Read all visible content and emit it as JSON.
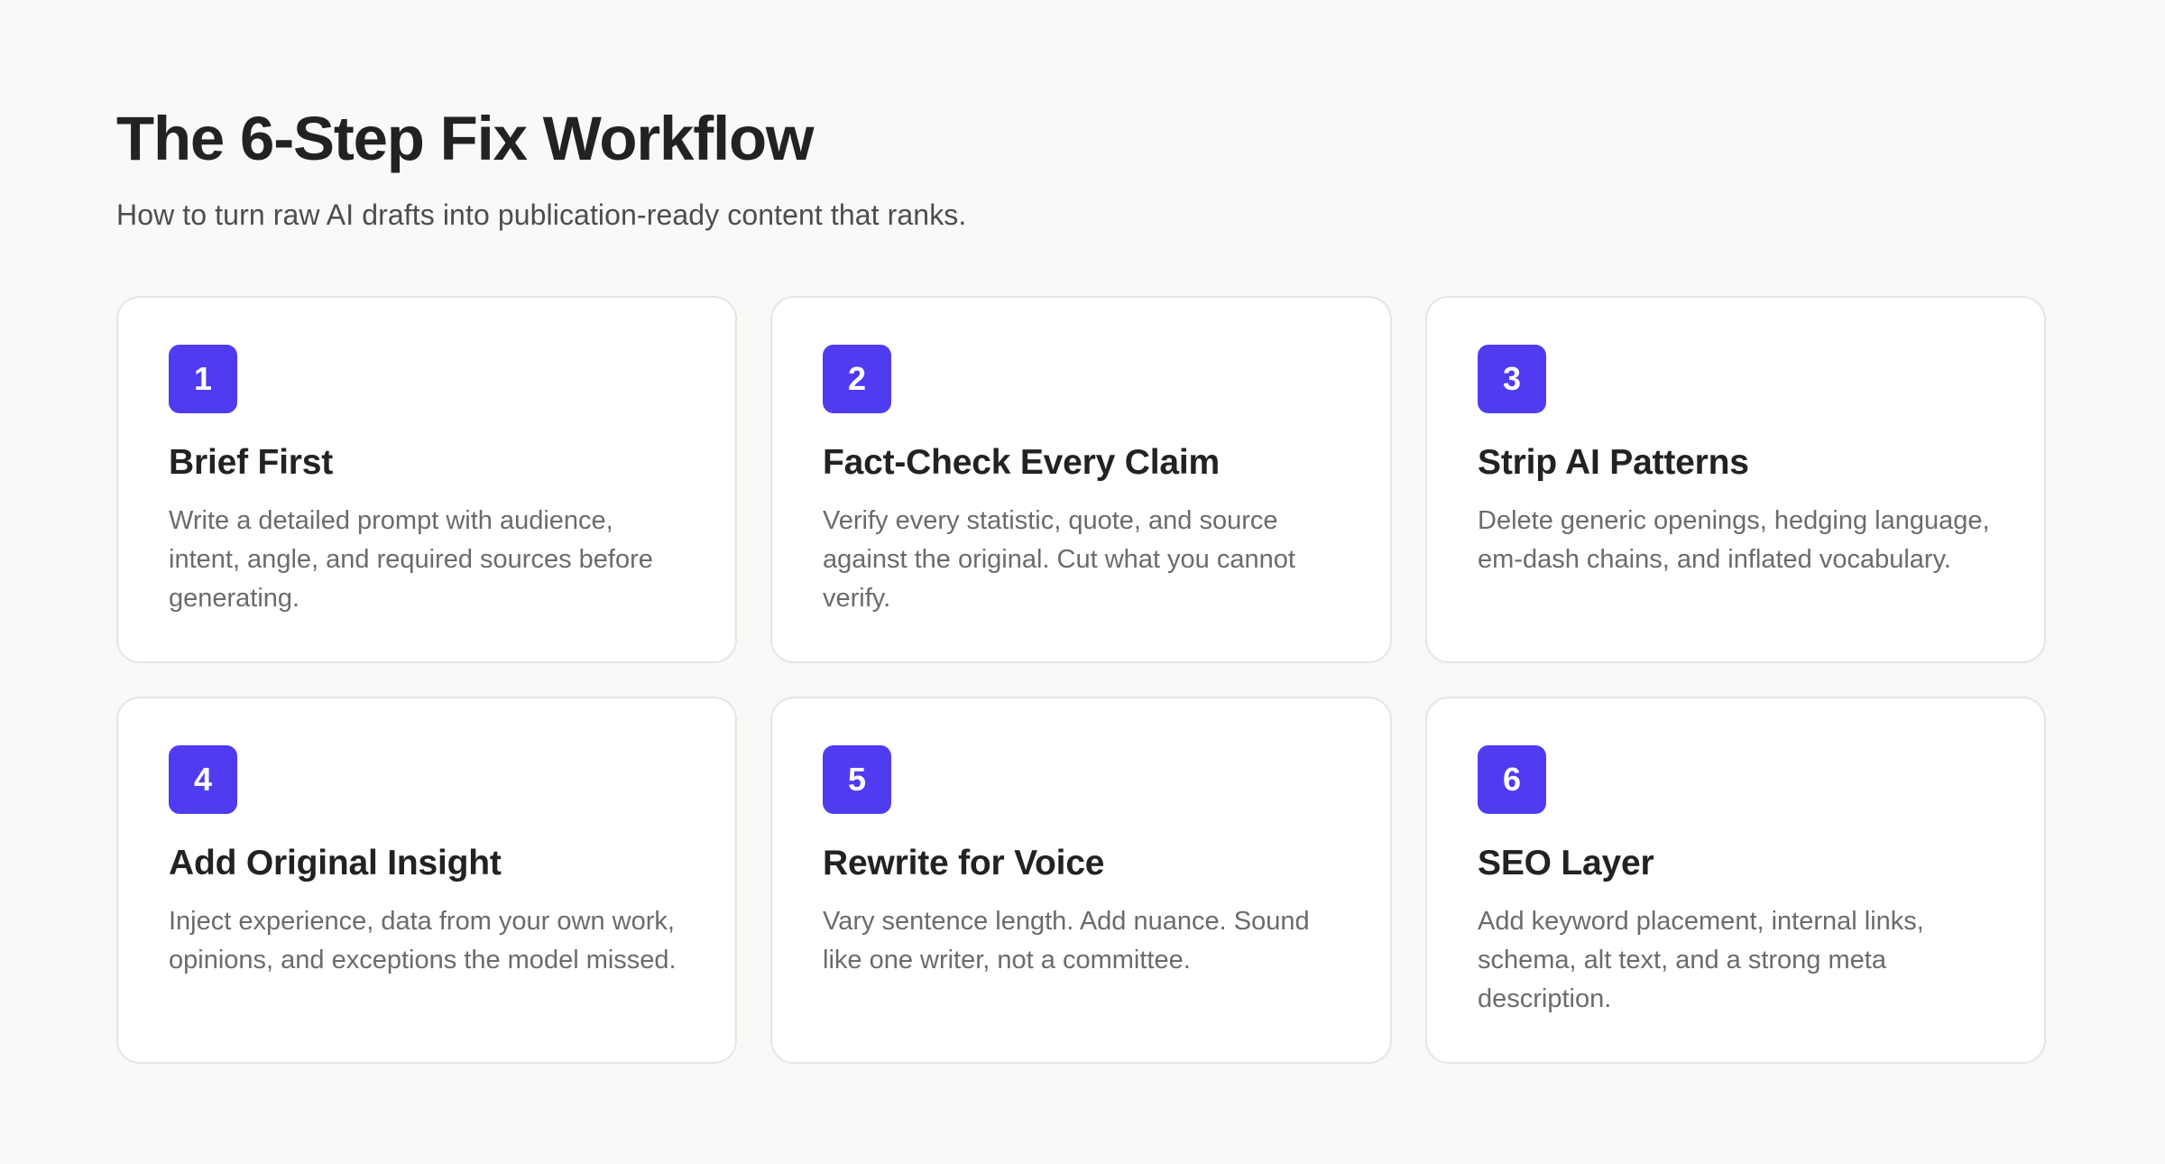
{
  "header": {
    "title": "The 6-Step Fix Workflow",
    "subtitle": "How to turn raw AI drafts into publication-ready content that ranks."
  },
  "colors": {
    "accent": "#4f3cf0",
    "background": "#faf9f7",
    "card": "#ffffff",
    "text": "#222222",
    "muted": "#6b6b6b"
  },
  "steps": [
    {
      "number": "1",
      "title": "Brief First",
      "description": "Write a detailed prompt with audience, intent, angle, and required sources before generating."
    },
    {
      "number": "2",
      "title": "Fact-Check Every Claim",
      "description": "Verify every statistic, quote, and source against the original. Cut what you cannot verify."
    },
    {
      "number": "3",
      "title": "Strip AI Patterns",
      "description": "Delete generic openings, hedging language, em-dash chains, and inflated vocabulary."
    },
    {
      "number": "4",
      "title": "Add Original Insight",
      "description": "Inject experience, data from your own work, opinions, and exceptions the model missed."
    },
    {
      "number": "5",
      "title": "Rewrite for Voice",
      "description": "Vary sentence length. Add nuance. Sound like one writer, not a committee."
    },
    {
      "number": "6",
      "title": "SEO Layer",
      "description": "Add keyword placement, internal links, schema, alt text, and a strong meta description."
    }
  ]
}
